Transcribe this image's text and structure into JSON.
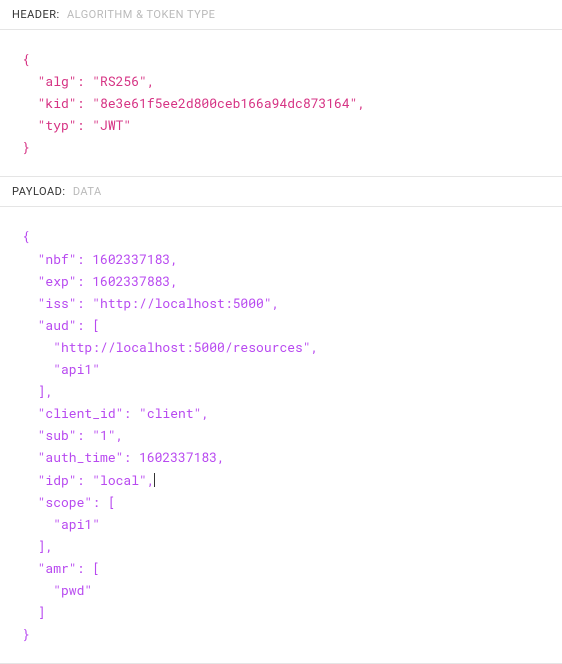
{
  "sections": {
    "header": {
      "title": "HEADER:",
      "subtitle": "ALGORITHM & TOKEN TYPE",
      "json": {
        "alg": "RS256",
        "kid": "8e3e61f5ee2d800ceb166a94dc873164",
        "typ": "JWT"
      }
    },
    "payload": {
      "title": "PAYLOAD:",
      "subtitle": "DATA",
      "json": {
        "nbf": 1602337183,
        "exp": 1602337883,
        "iss": "http://localhost:5000",
        "aud": [
          "http://localhost:5000/resources",
          "api1"
        ],
        "client_id": "client",
        "sub": "1",
        "auth_time": 1602337183,
        "idp": "local",
        "scope": [
          "api1"
        ],
        "amr": [
          "pwd"
        ]
      },
      "cursor_after_key": "idp"
    }
  }
}
